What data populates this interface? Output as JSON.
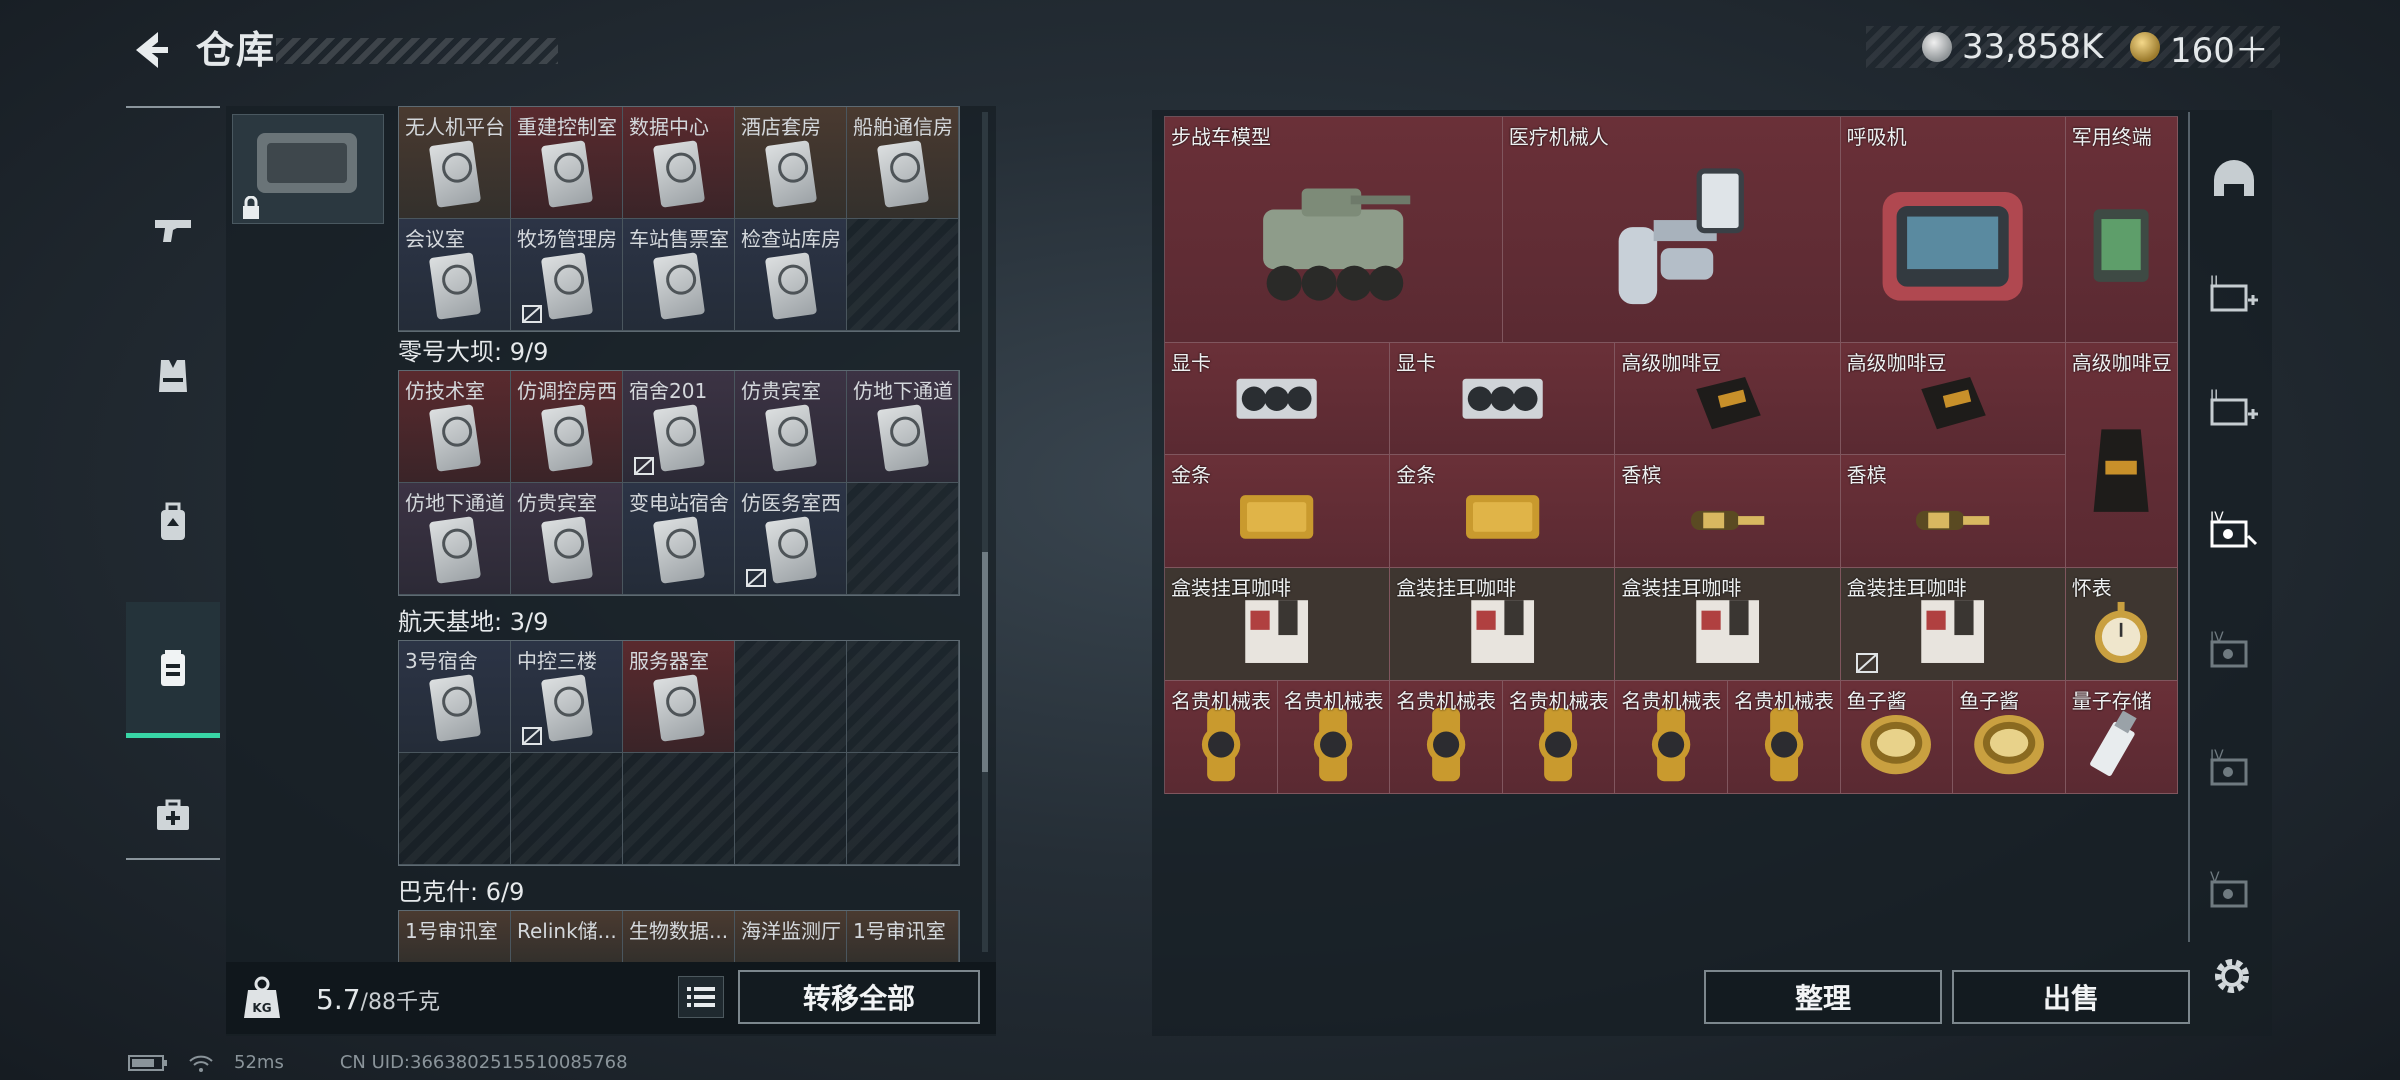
{
  "header": {
    "title": "仓库"
  },
  "currency": {
    "silver": "33,858K",
    "gold": "160＋"
  },
  "left_nav": {
    "items": [
      {
        "icon": "pistol-icon"
      },
      {
        "icon": "vest-icon"
      },
      {
        "icon": "backpack-icon"
      },
      {
        "icon": "keycard-case-icon",
        "active": true
      },
      {
        "icon": "medkit-icon"
      }
    ]
  },
  "stash": {
    "sections": [
      {
        "title": "",
        "rows": [
          [
            "无人机平台",
            "重建控制室",
            "数据中心",
            "酒店套房",
            "船舶通信房"
          ],
          [
            "会议室",
            "牧场管理房",
            "车站售票室",
            "检查站库房",
            ""
          ]
        ]
      },
      {
        "title": "零号大坝: 9/9",
        "rows": [
          [
            "仿技术室",
            "仿调控房西",
            "宿舍201",
            "仿贵宾室",
            "仿地下通道"
          ],
          [
            "仿地下通道",
            "仿贵宾室",
            "变电站宿舍",
            "仿医务室西",
            ""
          ]
        ]
      },
      {
        "title": "航天基地: 3/9",
        "rows": [
          [
            "3号宿舍",
            "中控三楼",
            "服务器室",
            "",
            ""
          ],
          [
            "",
            "",
            "",
            "",
            ""
          ]
        ]
      },
      {
        "title": "巴克什: 6/9",
        "rows": [
          [
            "1号审讯室",
            "Relink储...",
            "生物数据...",
            "海洋监测厅",
            "1号审讯室"
          ]
        ]
      }
    ],
    "weight": {
      "current": "5.7",
      "max": "/88千克"
    },
    "transfer_all_label": "转移全部"
  },
  "inventory": {
    "items": [
      {
        "name": "步战车模型",
        "art": "ifv"
      },
      {
        "name": "医疗机械人",
        "art": "robot"
      },
      {
        "name": "呼吸机",
        "art": "ventilator"
      },
      {
        "name": "军用终端",
        "art": "terminal"
      },
      {
        "name": "显卡",
        "art": "gpu"
      },
      {
        "name": "显卡",
        "art": "gpu"
      },
      {
        "name": "高级咖啡豆",
        "art": "coffee"
      },
      {
        "name": "高级咖啡豆",
        "art": "coffee"
      },
      {
        "name": "高级咖啡豆",
        "art": "coffee-tall"
      },
      {
        "name": "金条",
        "art": "gold"
      },
      {
        "name": "金条",
        "art": "gold"
      },
      {
        "name": "香槟",
        "art": "champagne"
      },
      {
        "name": "香槟",
        "art": "champagne"
      },
      {
        "name": "盒装挂耳咖啡",
        "art": "box"
      },
      {
        "name": "盒装挂耳咖啡",
        "art": "box"
      },
      {
        "name": "盒装挂耳咖啡",
        "art": "box"
      },
      {
        "name": "盒装挂耳咖啡",
        "art": "box"
      },
      {
        "name": "怀表",
        "art": "pocketwatch"
      },
      {
        "name": "名贵机械表",
        "art": "watch"
      },
      {
        "name": "名贵机械表",
        "art": "watch"
      },
      {
        "name": "名贵机械表",
        "art": "watch"
      },
      {
        "name": "名贵机械表",
        "art": "watch"
      },
      {
        "name": "名贵机械表",
        "art": "watch"
      },
      {
        "name": "名贵机械表",
        "art": "watch"
      },
      {
        "name": "鱼子酱",
        "art": "caviar"
      },
      {
        "name": "鱼子酱",
        "art": "caviar"
      },
      {
        "name": "量子存储",
        "art": "usb"
      }
    ],
    "sort_label": "整理",
    "sell_label": "出售"
  },
  "right_nav": {
    "items": [
      {
        "icon": "helmet-icon"
      },
      {
        "icon": "card-ii-add-icon"
      },
      {
        "icon": "card-ii-icon"
      },
      {
        "icon": "card-iv-active-icon"
      },
      {
        "icon": "card-iv-icon"
      },
      {
        "icon": "card-iv-icon"
      },
      {
        "icon": "card-v-icon"
      }
    ]
  },
  "status": {
    "ping": "52ms",
    "uid": "CN UID:3663802515510085768"
  }
}
